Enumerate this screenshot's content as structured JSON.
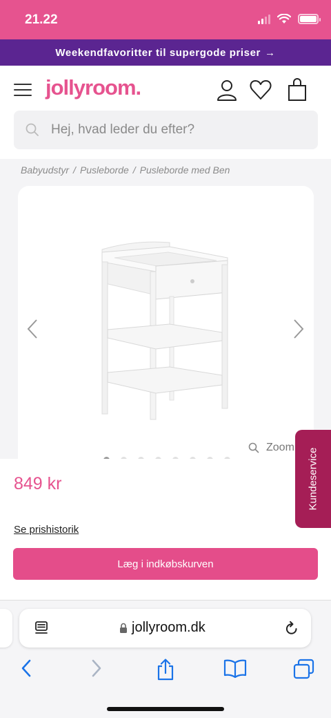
{
  "status_bar": {
    "time": "21.22",
    "accent_color": "#e6538f"
  },
  "promo": {
    "text": "Weekendfavoritter til supergode priser",
    "arrow": "→",
    "color": "#5b2591"
  },
  "header": {
    "logo": "jollyroom.",
    "icons": [
      "menu-icon",
      "account-icon",
      "heart-icon",
      "shopping-bag-icon"
    ]
  },
  "search": {
    "placeholder": "Hej, hvad leder du efter?"
  },
  "breadcrumb": [
    "Babyudstyr",
    "Pusleborde",
    "Pusleborde med Ben"
  ],
  "gallery": {
    "zoom_label": "Zoom",
    "dots_count": 8,
    "active_dot": 1
  },
  "product": {
    "price": "849 kr",
    "price_history_link": "Se prishistorik",
    "add_to_cart": "Læg i indkøbskurven",
    "button_color": "#e44d8a"
  },
  "customer_service": {
    "label": "Kundeservice",
    "color": "#a51e56"
  },
  "safari": {
    "url": "jollyroom.dk"
  }
}
